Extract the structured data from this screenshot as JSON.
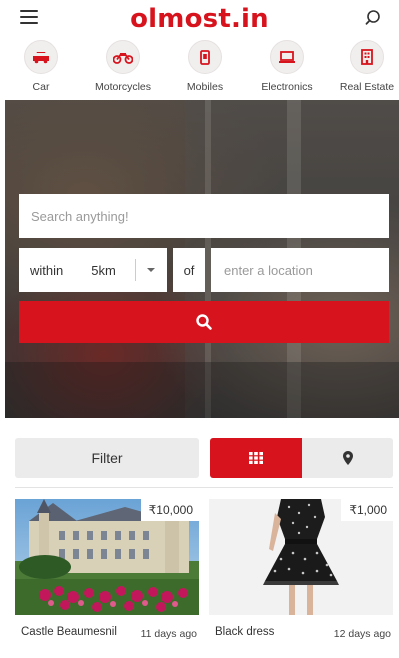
{
  "header": {
    "logo": "olmost.in"
  },
  "categories": [
    {
      "label": "Car",
      "icon": "car-icon"
    },
    {
      "label": "Motorcycles",
      "icon": "motorcycle-icon"
    },
    {
      "label": "Mobiles",
      "icon": "mobile-icon"
    },
    {
      "label": "Electronics",
      "icon": "laptop-icon"
    },
    {
      "label": "Real Estate",
      "icon": "building-icon"
    }
  ],
  "search": {
    "placeholder": "Search anything!",
    "within_label": "within",
    "radius_value": "5km",
    "of_label": "of",
    "location_placeholder": "enter a location"
  },
  "filter": {
    "filter_label": "Filter"
  },
  "listings": [
    {
      "title": "Castle Beaumesnil",
      "price": "₹10,000",
      "ago": "11 days ago"
    },
    {
      "title": "Black dress",
      "price": "₹1,000",
      "ago": "12 days ago"
    }
  ],
  "colors": {
    "brand": "#d7141d",
    "icon_bg": "#f1eeee"
  }
}
